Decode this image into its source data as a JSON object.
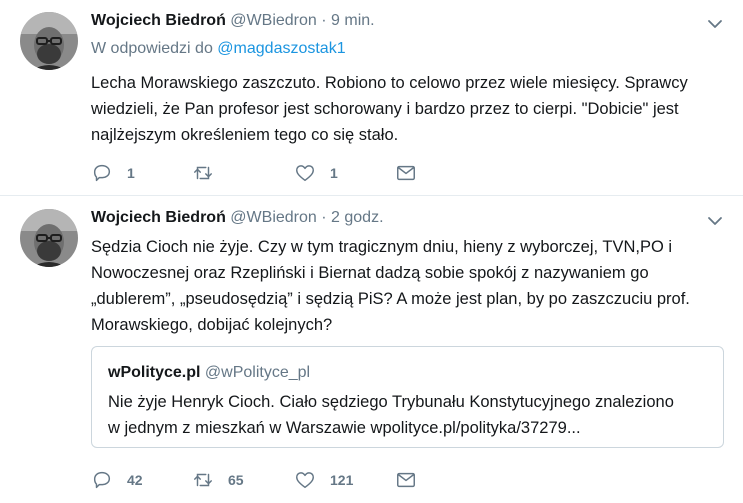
{
  "tweets": [
    {
      "name": "Wojciech Biedroń",
      "handle": "@WBiedron",
      "dot": "·",
      "time": "9 min.",
      "reply_prefix": "W odpowiedzi do",
      "reply_handle": "@magdaszostak1",
      "text": "Lecha Morawskiego zaszczuto. Robiono to celowo przez wiele miesięcy. Sprawcy\nwiedzieli, że Pan profesor jest schorowany i bardzo przez to cierpi. \"Dobicie\" jest\nnajlżejszym określeniem tego co się stało.",
      "replies": "1",
      "retweets": "",
      "likes": "1"
    },
    {
      "name": "Wojciech Biedroń",
      "handle": "@WBiedron",
      "dot": "·",
      "time": "2 godz.",
      "text": "Sędzia Cioch nie żyje. Czy w tym tragicznym dniu, hieny z wyborczej, TVN,PO i\nNowoczesnej oraz Rzepliński i Biernat dadzą sobie spokój z nazywaniem go\n„dublerem”, „pseudosędzią” i sędzią PiS? A może jest plan, by po zaszczuciu prof.\nMorawskiego, dobijać kolejnych?",
      "quote": {
        "name": "wPolityce.pl",
        "handle": "@wPolityce_pl",
        "text": "Nie żyje Henryk Cioch. Ciało sędziego Trybunału Konstytucyjnego znaleziono\nw jednym z mieszkań w Warszawie wpolityce.pl/polityka/37279..."
      },
      "replies": "42",
      "retweets": "65",
      "likes": "121"
    }
  ],
  "icons": {
    "reply": "reply-icon",
    "retweet": "retweet-icon",
    "like": "heart-icon",
    "dm": "envelope-icon",
    "caret": "chevron-down-icon"
  },
  "colors": {
    "link": "#1b95e0",
    "secondary": "#657786",
    "text": "#14171a",
    "border": "#e6ecf0"
  }
}
